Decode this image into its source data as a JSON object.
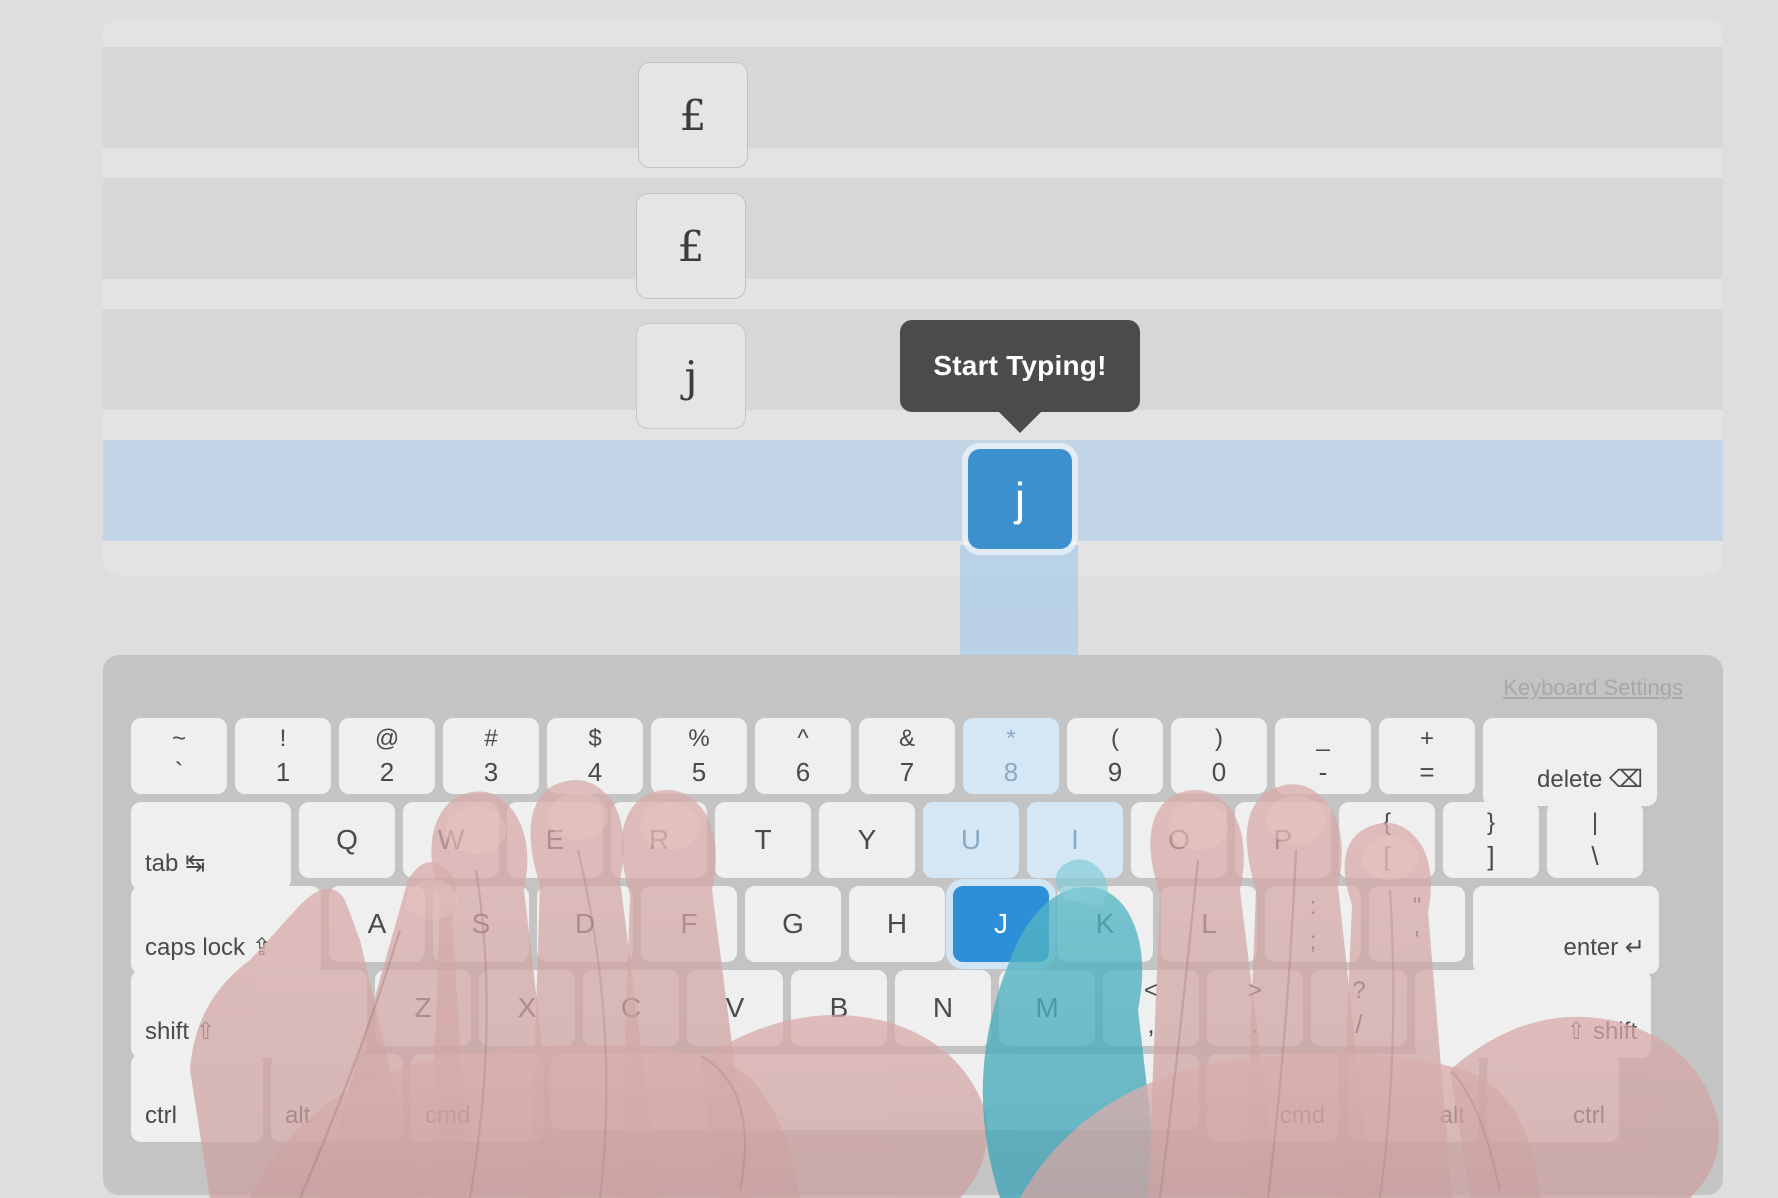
{
  "lesson": {
    "rows": [
      {
        "id": "row-1",
        "char": "£"
      },
      {
        "id": "row-2",
        "char": "£"
      },
      {
        "id": "row-3",
        "char": "j"
      },
      {
        "id": "row-4",
        "char": "j",
        "active": true
      }
    ],
    "highlight_color": "#c3d4e6",
    "active_tile_color": "#3d90ce"
  },
  "tooltip": {
    "text": "Start Typing!",
    "background": "#4b4b4b",
    "text_color": "#ffffff"
  },
  "keyboard": {
    "settings_link": "Keyboard Settings",
    "active_key": "J",
    "highlighted_keys": [
      "8",
      "U",
      "I"
    ],
    "rows": [
      {
        "name": "number-row",
        "keys": [
          {
            "name": "backtick",
            "top": "~",
            "bottom": "`"
          },
          {
            "name": "1",
            "top": "!",
            "bottom": "1"
          },
          {
            "name": "2",
            "top": "@",
            "bottom": "2"
          },
          {
            "name": "3",
            "top": "#",
            "bottom": "3"
          },
          {
            "name": "4",
            "top": "$",
            "bottom": "4"
          },
          {
            "name": "5",
            "top": "%",
            "bottom": "5"
          },
          {
            "name": "6",
            "top": "^",
            "bottom": "6"
          },
          {
            "name": "7",
            "top": "&",
            "bottom": "7"
          },
          {
            "name": "8",
            "top": "*",
            "bottom": "8",
            "highlight": true
          },
          {
            "name": "9",
            "top": "(",
            "bottom": "9"
          },
          {
            "name": "0",
            "top": ")",
            "bottom": "0"
          },
          {
            "name": "minus",
            "top": "_",
            "bottom": "-"
          },
          {
            "name": "equals",
            "top": "+",
            "bottom": "="
          },
          {
            "name": "delete",
            "label": "delete ⌫",
            "width": "w-del",
            "align": "right"
          }
        ]
      },
      {
        "name": "top-letter-row",
        "keys": [
          {
            "name": "tab",
            "label": "tab ↹",
            "width": "w-tab",
            "align": "left"
          },
          {
            "name": "q",
            "label": "Q"
          },
          {
            "name": "w",
            "label": "W"
          },
          {
            "name": "e",
            "label": "E"
          },
          {
            "name": "r",
            "label": "R"
          },
          {
            "name": "t",
            "label": "T"
          },
          {
            "name": "y",
            "label": "Y"
          },
          {
            "name": "u",
            "label": "U",
            "highlight": true
          },
          {
            "name": "i",
            "label": "I",
            "highlight": true
          },
          {
            "name": "o",
            "label": "O"
          },
          {
            "name": "p",
            "label": "P"
          },
          {
            "name": "bracket-left",
            "top": "{",
            "bottom": "["
          },
          {
            "name": "bracket-right",
            "top": "}",
            "bottom": "]"
          },
          {
            "name": "backslash",
            "top": "|",
            "bottom": "\\"
          }
        ]
      },
      {
        "name": "home-row",
        "keys": [
          {
            "name": "caps-lock",
            "label": "caps lock ⇪",
            "width": "w-caps",
            "align": "left"
          },
          {
            "name": "a",
            "label": "A"
          },
          {
            "name": "s",
            "label": "S"
          },
          {
            "name": "d",
            "label": "D"
          },
          {
            "name": "f",
            "label": "F"
          },
          {
            "name": "g",
            "label": "G"
          },
          {
            "name": "h",
            "label": "H"
          },
          {
            "name": "j",
            "label": "J",
            "active": true
          },
          {
            "name": "k",
            "label": "K"
          },
          {
            "name": "l",
            "label": "L"
          },
          {
            "name": "semicolon",
            "top": ":",
            "bottom": ";"
          },
          {
            "name": "quote",
            "top": "\"",
            "bottom": "'"
          },
          {
            "name": "enter",
            "label": "enter ↵",
            "width": "w-enter",
            "align": "right"
          }
        ]
      },
      {
        "name": "bottom-letter-row",
        "keys": [
          {
            "name": "shift-left",
            "label": "shift ⇧",
            "width": "w-lshift",
            "align": "left"
          },
          {
            "name": "z",
            "label": "Z"
          },
          {
            "name": "x",
            "label": "X"
          },
          {
            "name": "c",
            "label": "C"
          },
          {
            "name": "v",
            "label": "V"
          },
          {
            "name": "b",
            "label": "B"
          },
          {
            "name": "n",
            "label": "N"
          },
          {
            "name": "m",
            "label": "M"
          },
          {
            "name": "comma",
            "top": "<",
            "bottom": ","
          },
          {
            "name": "period",
            "top": ">",
            "bottom": "."
          },
          {
            "name": "slash",
            "top": "?",
            "bottom": "/"
          },
          {
            "name": "shift-right",
            "label": "⇧ shift",
            "width": "w-rshift",
            "align": "right"
          }
        ]
      },
      {
        "name": "modifier-row",
        "keys": [
          {
            "name": "ctrl-left",
            "label": "ctrl",
            "width": "w-mod",
            "align": "left"
          },
          {
            "name": "alt-left",
            "label": "alt",
            "width": "w-mod",
            "align": "left"
          },
          {
            "name": "cmd-left",
            "label": "cmd",
            "width": "w-mod",
            "align": "left"
          },
          {
            "name": "space",
            "label": "",
            "width": "w-space"
          },
          {
            "name": "cmd-right",
            "label": "cmd",
            "width": "w-mod",
            "align": "right"
          },
          {
            "name": "alt-right",
            "label": "alt",
            "width": "w-mod",
            "align": "right"
          },
          {
            "name": "ctrl-right",
            "label": "ctrl",
            "width": "w-mod",
            "align": "right"
          }
        ]
      }
    ]
  }
}
